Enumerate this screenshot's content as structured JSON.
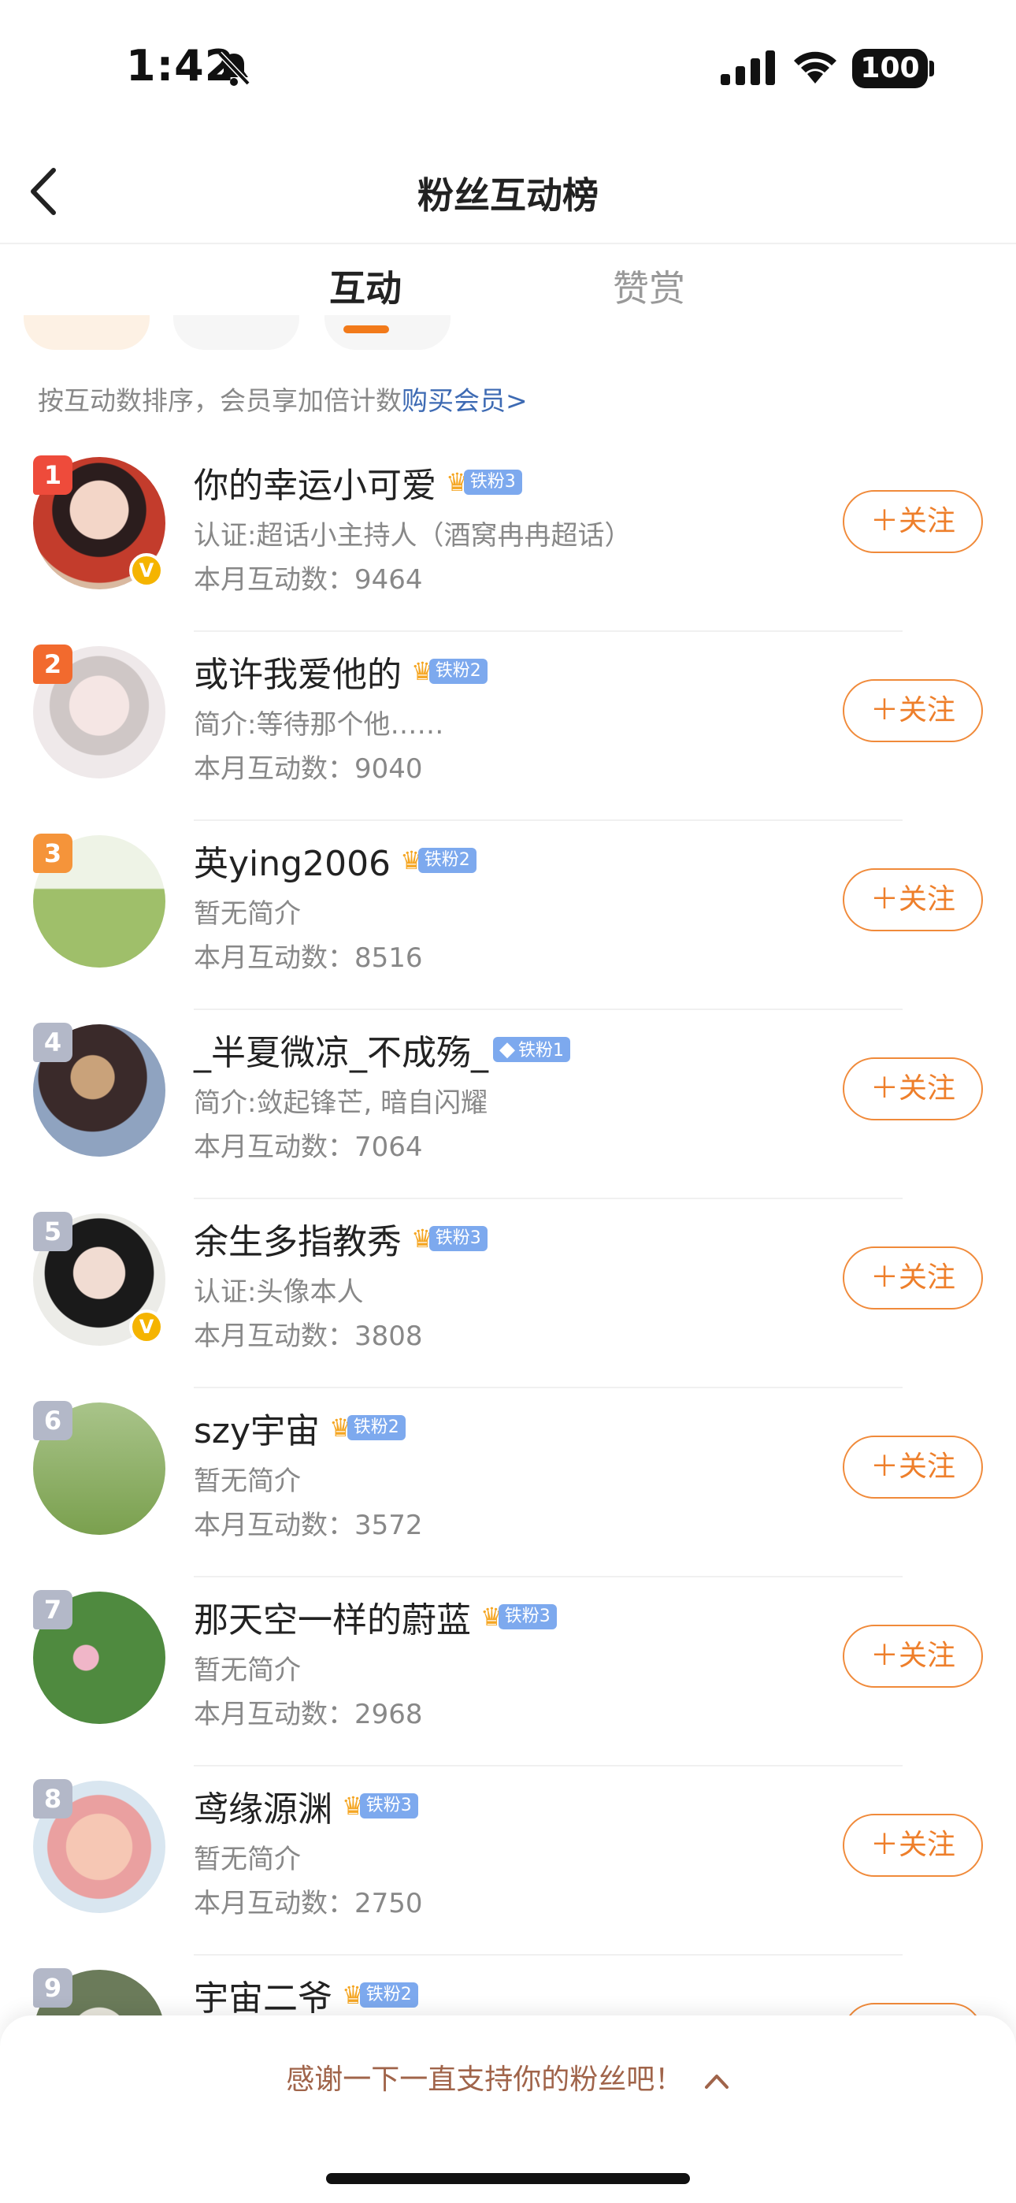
{
  "status": {
    "time": "1:42",
    "battery": "100"
  },
  "nav": {
    "title": "粉丝互动榜"
  },
  "tabs": [
    {
      "label": "互动"
    },
    {
      "label": "赞赏"
    }
  ],
  "sort_note": {
    "text": "按互动数排序，会员享加倍计数",
    "link": "购买会员>"
  },
  "follow_label": "＋关注",
  "colors": {
    "accent": "#f27a1a",
    "badge": "#7da9ee",
    "link": "#3d6ab3"
  },
  "fans": [
    {
      "rank": "1",
      "name": "你的幸运小可爱",
      "badge": "铁粉3",
      "badge_icon": "crown-icon",
      "desc": "认证:超话小主持人（酒窝冉冉超话）",
      "count": "本月互动数：9464",
      "verified": true,
      "rank_color": "#ee4b3b"
    },
    {
      "rank": "2",
      "name": "或许我爱他的",
      "badge": "铁粉2",
      "badge_icon": "crown-icon",
      "desc": "简介:等待那个他……",
      "count": "本月互动数：9040",
      "verified": false,
      "rank_color": "#f26a2e"
    },
    {
      "rank": "3",
      "name": "英ying2006",
      "badge": "铁粉2",
      "badge_icon": "crown-icon",
      "desc": "暂无简介",
      "count": "本月互动数：8516",
      "verified": false,
      "rank_color": "#f5943a"
    },
    {
      "rank": "4",
      "name": "_半夏微凉_不成殇_",
      "badge": "铁粉1",
      "badge_icon": "diamond-icon",
      "desc": "简介:敛起锋芒, 暗自闪耀",
      "count": "本月互动数：7064",
      "verified": false,
      "rank_color": "#b3b8c8"
    },
    {
      "rank": "5",
      "name": "余生多指教秀",
      "badge": "铁粉3",
      "badge_icon": "crown-icon",
      "desc": "认证:头像本人",
      "count": "本月互动数：3808",
      "verified": true,
      "rank_color": "#b3b8c8"
    },
    {
      "rank": "6",
      "name": "szy宇宙",
      "badge": "铁粉2",
      "badge_icon": "crown-icon",
      "desc": "暂无简介",
      "count": "本月互动数：3572",
      "verified": false,
      "rank_color": "#b3b8c8"
    },
    {
      "rank": "7",
      "name": "那天空一样的蔚蓝",
      "badge": "铁粉3",
      "badge_icon": "crown-icon",
      "desc": "暂无简介",
      "count": "本月互动数：2968",
      "verified": false,
      "rank_color": "#b3b8c8"
    },
    {
      "rank": "8",
      "name": "鸢缘源渊",
      "badge": "铁粉3",
      "badge_icon": "crown-icon",
      "desc": "暂无简介",
      "count": "本月互动数：2750",
      "verified": false,
      "rank_color": "#b3b8c8"
    },
    {
      "rank": "9",
      "name": "宇宙二爷",
      "badge": "铁粉2",
      "badge_icon": "crown-icon",
      "desc": "",
      "count": "",
      "verified": false,
      "rank_color": "#b3b8c8"
    }
  ],
  "bottom": {
    "thanks": "感谢一下一直支持你的粉丝吧！"
  }
}
